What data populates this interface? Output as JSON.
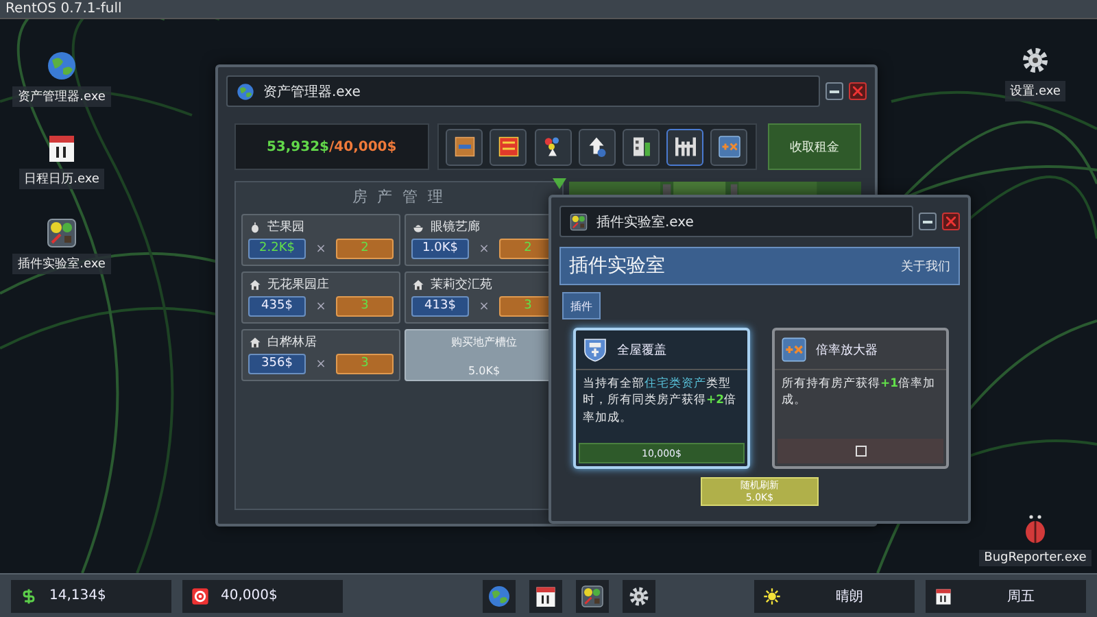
{
  "top_bar": {
    "title": "RentOS 0.7.1-full"
  },
  "desktop_icons": [
    {
      "label": "资产管理器.exe",
      "kind": "globe"
    },
    {
      "label": "日程日历.exe",
      "kind": "calendar"
    },
    {
      "label": "插件实验室.exe",
      "kind": "plugin"
    },
    {
      "label": "设置.exe",
      "kind": "gear"
    },
    {
      "label": "BugReporter.exe",
      "kind": "bug"
    }
  ],
  "asset_window": {
    "title": "资产管理器.exe",
    "balance": "53,932$",
    "target": "/40,000$",
    "plugins": [
      {
        "kind": "boost",
        "selected": false
      },
      {
        "kind": "cash",
        "selected": false
      },
      {
        "kind": "balloons",
        "selected": false
      },
      {
        "kind": "upgrade",
        "selected": false
      },
      {
        "kind": "building",
        "selected": false
      },
      {
        "kind": "fence",
        "selected": true
      },
      {
        "kind": "multiplier",
        "selected": false
      }
    ],
    "collect_button": "收取租金",
    "property_panel": {
      "title": "房 产 管 理",
      "properties": [
        {
          "name": "芒果园",
          "kind": "fruit",
          "income": "2.2K$",
          "multiplier": "2",
          "highlight": true
        },
        {
          "name": "眼镜艺廊",
          "kind": "bowl",
          "income": "1.0K$",
          "multiplier": "2",
          "highlight": false
        },
        {
          "name": "无花果园庄",
          "kind": "house",
          "income": "435$",
          "multiplier": "3",
          "highlight": false
        },
        {
          "name": "茉莉交汇苑",
          "kind": "house",
          "income": "413$",
          "multiplier": "3",
          "highlight": false
        },
        {
          "name": "白桦林居",
          "kind": "house",
          "income": "356$",
          "multiplier": "3",
          "highlight": false
        }
      ],
      "buy_slot": {
        "label": "购买地产槽位",
        "price": "5.0K$"
      },
      "times": "×"
    }
  },
  "plugin_window": {
    "title": "插件实验室.exe",
    "heading": "插件实验室",
    "about": "关于我们",
    "tabs": [
      {
        "label": "插件",
        "selected": true
      }
    ],
    "cards": [
      {
        "name": "全屋覆盖",
        "kind": "price",
        "selected": true,
        "description": [
          {
            "text": "当持有全部",
            "kind": "plain"
          },
          {
            "text": "住宅类资产",
            "kind": "keyword"
          },
          {
            "text": "类型时，所有同类房产获得",
            "kind": "plain"
          },
          {
            "text": "+2",
            "kind": "bonus"
          },
          {
            "text": "倍率加成。",
            "kind": "plain"
          }
        ],
        "price": "10,000$"
      },
      {
        "name": "倍率放大器",
        "kind": "checkbox",
        "selected": false,
        "description": [
          {
            "text": "所有持有房产获得",
            "kind": "plain"
          },
          {
            "text": "+1",
            "kind": "bonus"
          },
          {
            "text": "倍率加成。",
            "kind": "plain"
          }
        ],
        "checked": false
      }
    ],
    "refresh_button": {
      "label": "随机刷新",
      "price": "5.0K$"
    }
  },
  "taskbar": {
    "money": "14,134$",
    "goal": "40,000$",
    "weather": "晴朗",
    "day": "周五"
  }
}
